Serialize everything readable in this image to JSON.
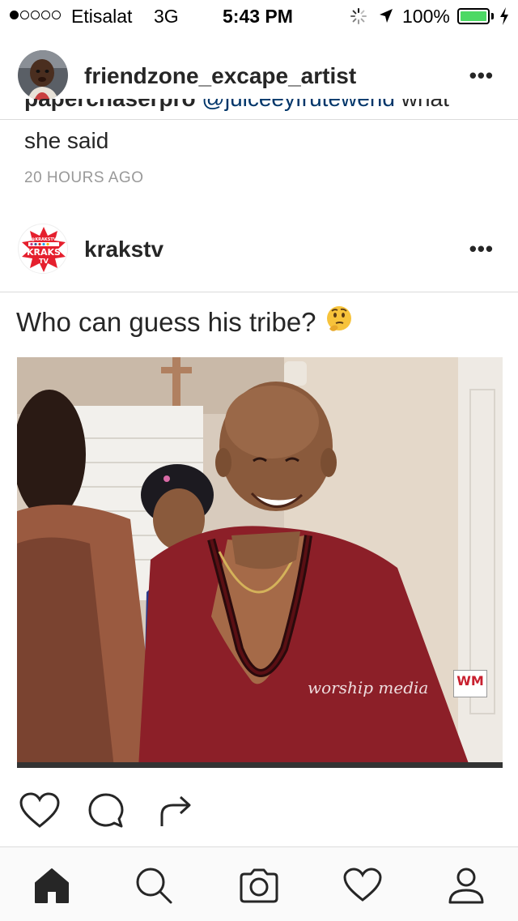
{
  "status_bar": {
    "carrier": "Etisalat",
    "network": "3G",
    "time": "5:43 PM",
    "battery": "100%",
    "battery_level": 1.0,
    "signal_bars_filled": 1,
    "signal_bars_total": 5
  },
  "previous_post": {
    "username": "friendzone_excape_artist",
    "caption_author": "paperchaserpro",
    "caption_mention": "@juiceeyfrutewerld",
    "caption_tail": "what",
    "caption_end": "she said",
    "timestamp": "20 HOURS AGO"
  },
  "post": {
    "username": "krakstv",
    "avatar_text_top": "@KRAKSTV",
    "avatar_text_main": "KRAKS",
    "avatar_text_sub": "TV",
    "caption": "Who can guess his tribe?",
    "caption_emoji": "🤔",
    "watermark": "worship media",
    "watermark_logo": "WM"
  },
  "more_label": "•••",
  "tab_bar": {
    "items": [
      {
        "name": "home",
        "icon": "home-icon"
      },
      {
        "name": "search",
        "icon": "search-icon"
      },
      {
        "name": "camera",
        "icon": "camera-icon"
      },
      {
        "name": "activity",
        "icon": "heart-icon"
      },
      {
        "name": "profile",
        "icon": "person-icon"
      }
    ]
  },
  "colors": {
    "text": "#262626",
    "muted": "#999999",
    "divider": "#dbdbdb",
    "battery": "#4cd964",
    "mention": "#003569"
  }
}
